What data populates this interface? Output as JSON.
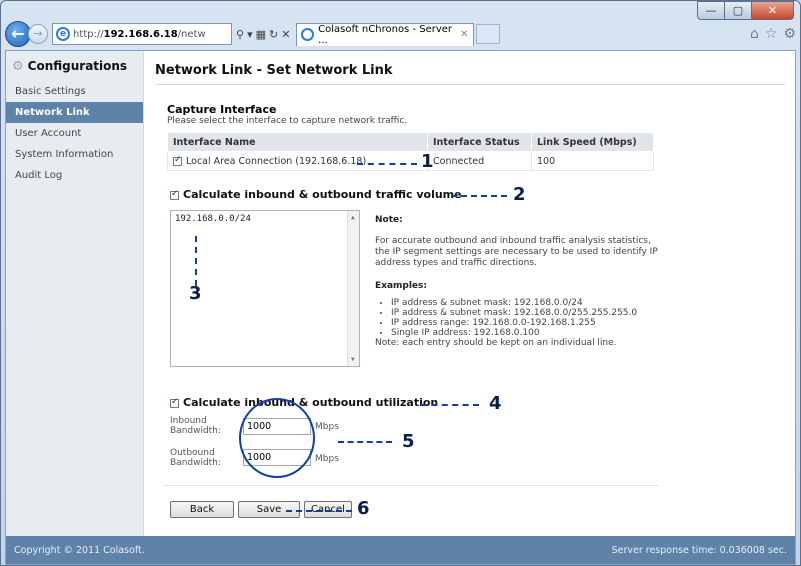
{
  "browser": {
    "address_prefix": "http://",
    "address_host": "192.168.6.18",
    "address_rest": "/netw",
    "tab_title": "Colasoft nChronos - Server ...",
    "win_min": "—",
    "win_max": "▢",
    "win_close": "✕"
  },
  "sidebar": {
    "title": "Configurations",
    "items": [
      {
        "label": "Basic Settings"
      },
      {
        "label": "Network Link"
      },
      {
        "label": "User Account"
      },
      {
        "label": "System Information"
      },
      {
        "label": "Audit Log"
      }
    ]
  },
  "main": {
    "page_title": "Network Link - Set Network Link",
    "capture": {
      "title": "Capture Interface",
      "description": "Please select the interface to capture network traffic.",
      "columns": [
        "Interface Name",
        "Interface Status",
        "Link Speed (Mbps)"
      ],
      "rows": [
        {
          "name": "Local Area Connection (192.168.6.18)",
          "status": "Connected",
          "speed": "100",
          "checked": true
        }
      ]
    },
    "traffic_volume": {
      "label": "Calculate inbound & outbound traffic volume",
      "checked": true,
      "ip_segments": "192.168.0.0/24"
    },
    "note": {
      "heading": "Note:",
      "text": "For accurate outbound and inbound traffic analysis statistics, the IP segment settings are necessary to be used to identify IP address types and traffic directions.",
      "examples_heading": "Examples:",
      "examples": [
        "IP address & subnet mask: 192.168.0.0/24",
        "IP address & subnet mask: 192.168.0.0/255.255.255.0",
        "IP address range: 192.168.0.0-192.168.1.255",
        "Single IP address: 192.168.0.100"
      ],
      "footer": "Note: each entry should be kept on an individual line."
    },
    "utilization": {
      "label": "Calculate inbound & outbound utilization",
      "checked": true,
      "inbound_label_1": "Inbound",
      "inbound_label_2": "Bandwidth:",
      "inbound_value": "1000",
      "outbound_label_1": "Outbound",
      "outbound_label_2": "Bandwidth:",
      "outbound_value": "1000",
      "unit": "Mbps"
    },
    "buttons": {
      "back": "Back",
      "save": "Save",
      "cancel": "Cancel"
    },
    "annotations": [
      "1",
      "2",
      "3",
      "4",
      "5",
      "6"
    ]
  },
  "footer": {
    "copyright": "Copyright © 2011 Colasoft.",
    "response_time": "Server response time: 0.036008 sec."
  }
}
